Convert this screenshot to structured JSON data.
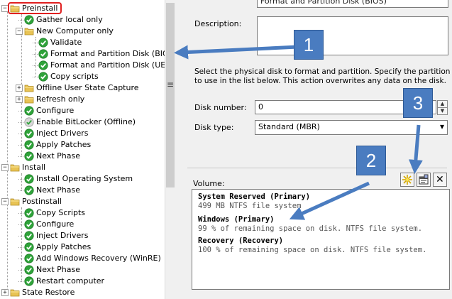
{
  "tree": {
    "items": [
      {
        "label": "Preinstall",
        "icon": "folder",
        "level": 0,
        "expander": "−",
        "selected": true
      },
      {
        "label": "Gather local only",
        "icon": "check",
        "level": 1
      },
      {
        "label": "New Computer only",
        "icon": "folder",
        "level": 1,
        "expander": "−"
      },
      {
        "label": "Validate",
        "icon": "check",
        "level": 2
      },
      {
        "label": "Format and Partition Disk (BIOS)",
        "icon": "check",
        "level": 2
      },
      {
        "label": "Format and Partition Disk (UEFI)",
        "icon": "check",
        "level": 2
      },
      {
        "label": "Copy scripts",
        "icon": "check",
        "level": 2
      },
      {
        "label": "Offline User State Capture",
        "icon": "folder",
        "level": 1,
        "expander": "+"
      },
      {
        "label": "Refresh only",
        "icon": "folder",
        "level": 1,
        "expander": "+"
      },
      {
        "label": "Configure",
        "icon": "check",
        "level": 1
      },
      {
        "label": "Enable BitLocker (Offline)",
        "icon": "check-gray",
        "level": 1
      },
      {
        "label": "Inject Drivers",
        "icon": "check",
        "level": 1
      },
      {
        "label": "Apply Patches",
        "icon": "check",
        "level": 1
      },
      {
        "label": "Next Phase",
        "icon": "check",
        "level": 1
      },
      {
        "label": "Install",
        "icon": "folder",
        "level": 0,
        "expander": "−"
      },
      {
        "label": "Install Operating System",
        "icon": "check",
        "level": 1
      },
      {
        "label": "Next Phase",
        "icon": "check",
        "level": 1
      },
      {
        "label": "Postinstall",
        "icon": "folder",
        "level": 0,
        "expander": "−"
      },
      {
        "label": "Copy Scripts",
        "icon": "check",
        "level": 1
      },
      {
        "label": "Configure",
        "icon": "check",
        "level": 1
      },
      {
        "label": "Inject Drivers",
        "icon": "check",
        "level": 1
      },
      {
        "label": "Apply Patches",
        "icon": "check",
        "level": 1
      },
      {
        "label": "Add Windows Recovery (WinRE)",
        "icon": "check",
        "level": 1
      },
      {
        "label": "Next Phase",
        "icon": "check",
        "level": 1
      },
      {
        "label": "Restart computer",
        "icon": "check",
        "level": 1
      },
      {
        "label": "State Restore",
        "icon": "folder",
        "level": 0,
        "expander": "+"
      }
    ]
  },
  "properties": {
    "name_value": "Format and Partition Disk (BIOS)",
    "description_label": "Description:",
    "description_value": "",
    "instructions_line1": "Select the physical disk to format and partition.  Specify the partition layout",
    "instructions_line2": "to use in the list below. This action overwrites any data on the disk.",
    "disk_number_label": "Disk number:",
    "disk_number_value": "0",
    "disk_type_label": "Disk type:",
    "disk_type_value": "Standard (MBR)",
    "volume_label": "Volume:",
    "volumes": [
      {
        "name": "System Reserved (Primary)",
        "desc": "499 MB NTFS file system"
      },
      {
        "name": "Windows (Primary)",
        "desc": "99 % of remaining space on disk. NTFS file system."
      },
      {
        "name": "Recovery (Recovery)",
        "desc": "100 % of remaining space on disk. NTFS file system."
      }
    ]
  },
  "callouts": [
    "1",
    "2",
    "3"
  ],
  "icons": {
    "grip": "≡",
    "spin_up": "▲",
    "spin_down": "▼",
    "dropdown": "▾",
    "new": "new-star-icon",
    "properties": "properties-icon",
    "delete": "✕"
  },
  "colors": {
    "accent": "#4a7cc0",
    "check_green": "#2fa33a",
    "selection_red": "#e02020",
    "folder": "#e8c355"
  }
}
